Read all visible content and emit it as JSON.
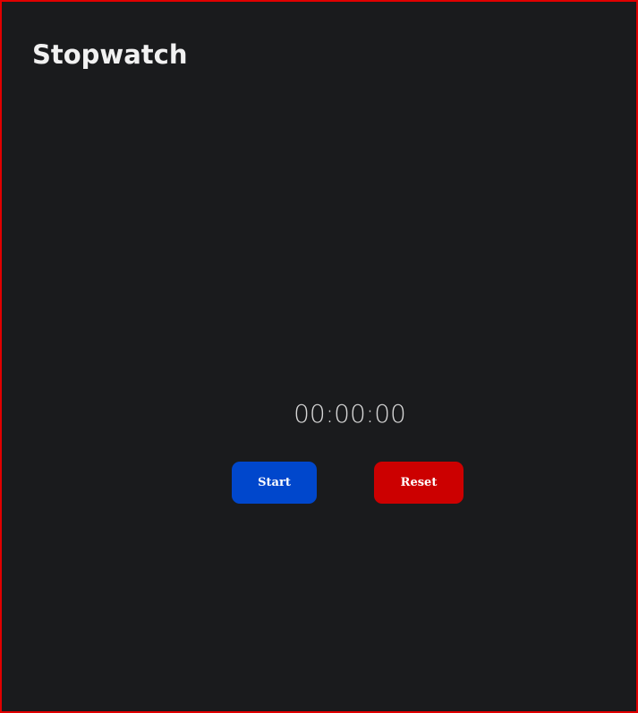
{
  "app": {
    "title": "Stopwatch"
  },
  "display": {
    "time": "00:00:00"
  },
  "controls": {
    "start_label": "Start",
    "reset_label": "Reset"
  },
  "colors": {
    "background": "#1a1b1d",
    "border": "#e00000",
    "start_button": "#0047cc",
    "reset_button": "#cc0000",
    "title_text": "#f1f1f1",
    "time_text": "#d6d6d6"
  }
}
